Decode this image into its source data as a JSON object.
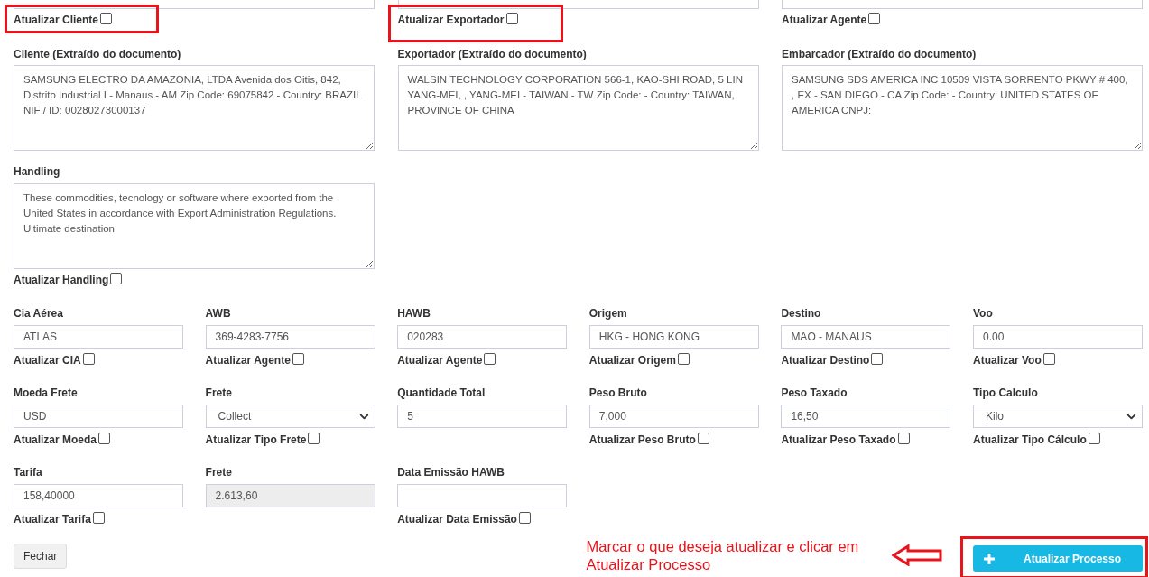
{
  "top_checks": [
    {
      "label": "Atualizar Cliente",
      "checked": false,
      "highlighted": true
    },
    {
      "label": "Atualizar Exportador",
      "checked": false,
      "highlighted": true
    },
    {
      "label": "Atualizar Agente",
      "checked": false,
      "highlighted": false
    }
  ],
  "parties": [
    {
      "label": "Cliente (Extraído do documento)",
      "value": "SAMSUNG ELECTRO DA AMAZONIA, LTDA Avenida dos Oitis, 842, Distrito Industrial I - Manaus - AM Zip Code: 69075842 - Country: BRAZIL NIF / ID: 00280273000137"
    },
    {
      "label": "Exportador (Extraído do documento)",
      "value": "WALSIN TECHNOLOGY CORPORATION 566-1, KAO-SHI ROAD, 5 LIN YANG-MEI, , YANG-MEI - TAIWAN - TW Zip Code: - Country: TAIWAN, PROVINCE OF CHINA"
    },
    {
      "label": "Embarcador (Extraído do documento)",
      "value": "SAMSUNG SDS AMERICA INC 10509 VISTA SORRENTO PKWY # 400, , EX - SAN DIEGO - CA Zip Code: - Country: UNITED STATES OF AMERICA CNPJ:"
    }
  ],
  "handling": {
    "label": "Handling",
    "value": "These commodities, tecnology or software where exported from the United States in accordance with Export Administration Regulations. Ultimate destination",
    "check": {
      "label": "Atualizar Handling",
      "checked": false
    }
  },
  "field_rows": [
    [
      {
        "kind": "input",
        "label": "Cia Aérea",
        "value": "ATLAS",
        "disabled": false,
        "check": {
          "label": "Atualizar CIA",
          "checked": false
        }
      },
      {
        "kind": "input",
        "label": "AWB",
        "value": "369-4283-7756",
        "disabled": false,
        "check": {
          "label": "Atualizar Agente",
          "checked": false
        }
      },
      {
        "kind": "input",
        "label": "HAWB",
        "value": "020283",
        "disabled": false,
        "check": {
          "label": "Atualizar Agente",
          "checked": false
        }
      },
      {
        "kind": "input",
        "label": "Origem",
        "value": "HKG - HONG KONG",
        "disabled": false,
        "check": {
          "label": "Atualizar Origem",
          "checked": false
        }
      },
      {
        "kind": "input",
        "label": "Destino",
        "value": "MAO - MANAUS",
        "disabled": false,
        "check": {
          "label": "Atualizar Destino",
          "checked": false
        }
      },
      {
        "kind": "input",
        "label": "Voo",
        "value": "0.00",
        "disabled": false,
        "check": {
          "label": "Atualizar Voo",
          "checked": false
        }
      }
    ],
    [
      {
        "kind": "input",
        "label": "Moeda Frete",
        "value": "USD",
        "disabled": false,
        "check": {
          "label": "Atualizar Moeda",
          "checked": false
        }
      },
      {
        "kind": "select",
        "label": "Frete",
        "value": "Collect",
        "disabled": false,
        "check": {
          "label": "Atualizar Tipo Frete",
          "checked": false
        }
      },
      {
        "kind": "input",
        "label": "Quantidade Total",
        "value": "5",
        "disabled": false
      },
      {
        "kind": "input",
        "label": "Peso Bruto",
        "value": "7,000",
        "disabled": false,
        "check": {
          "label": "Atualizar Peso Bruto",
          "checked": false
        }
      },
      {
        "kind": "input",
        "label": "Peso Taxado",
        "value": "16,50",
        "disabled": false,
        "check": {
          "label": "Atualizar Peso Taxado",
          "checked": false
        }
      },
      {
        "kind": "select",
        "label": "Tipo Calculo",
        "value": "Kilo",
        "disabled": false,
        "check": {
          "label": "Atualizar Tipo Cálculo",
          "checked": false
        }
      }
    ],
    [
      {
        "kind": "input",
        "label": "Tarifa",
        "value": "158,40000",
        "disabled": false,
        "check": {
          "label": "Atualizar Tarifa",
          "checked": false
        }
      },
      {
        "kind": "input",
        "label": "Frete",
        "value": "2.613,60",
        "disabled": true
      },
      {
        "kind": "input",
        "label": "Data Emissão HAWB",
        "disabled": false,
        "check": {
          "label": "Atualizar Data Emissão",
          "checked": false
        }
      }
    ]
  ],
  "close_button": "Fechar",
  "note": "Marcar o que deseja atualizar e clicar em Atualizar Processo",
  "action_button": {
    "label": "Atualizar Processo",
    "highlighted": true
  }
}
